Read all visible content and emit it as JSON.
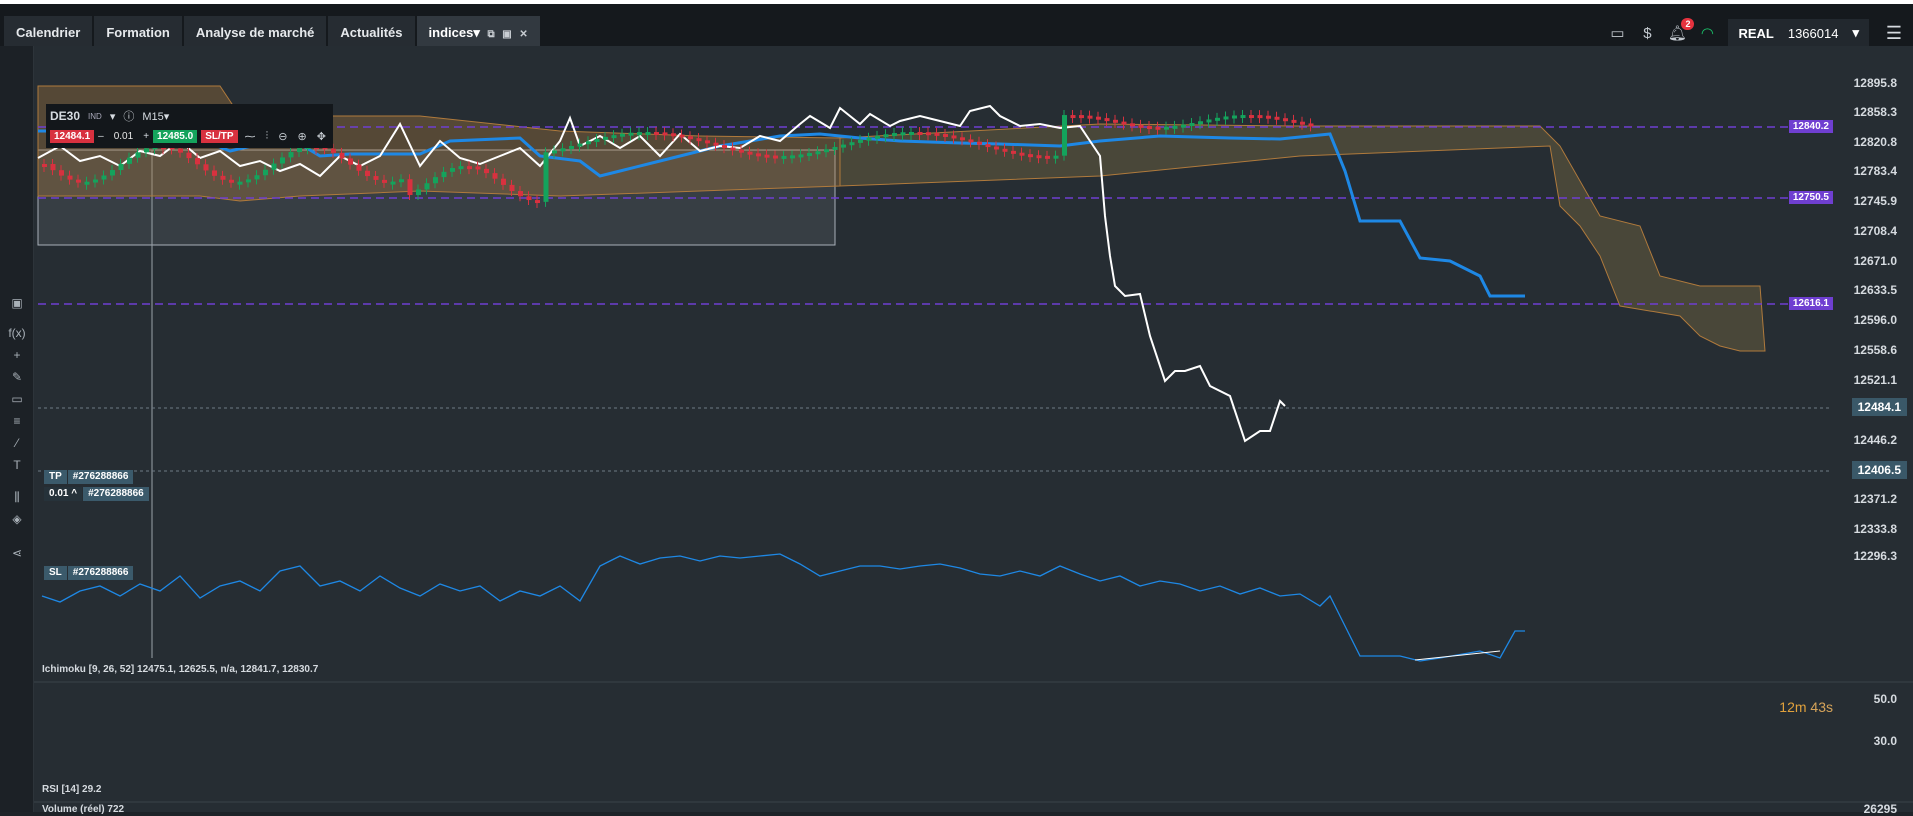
{
  "tabs": [
    {
      "label": "Calendrier"
    },
    {
      "label": "Formation"
    },
    {
      "label": "Analyse de marché"
    },
    {
      "label": "Actualités"
    },
    {
      "label": "indices▾"
    }
  ],
  "topbar_right": {
    "notifications_count": "2",
    "account_type": "REAL",
    "account_number": "1366014"
  },
  "instrument": {
    "symbol": "DE30",
    "tag": "IND",
    "timeframe": "M15▾",
    "sell_price": "12484.1",
    "qty": "0.01",
    "buy_price": "12485.0",
    "sltp_label": "SL/TP",
    "minus": "–",
    "plus": "+"
  },
  "price_axis": [
    "12895.8",
    "12858.3",
    "12820.8",
    "12783.4",
    "12745.9",
    "12708.4",
    "12671.0",
    "12633.5",
    "12596.0",
    "12558.6",
    "12521.1",
    "12446.2",
    "12371.2",
    "12333.8",
    "12296.3"
  ],
  "levels": {
    "hline1": "12840.2",
    "hline2": "12750.5",
    "hline3": "12616.1",
    "current": "12484.1",
    "sl": "12406.5"
  },
  "positions": {
    "tp_label": "TP",
    "tp_id": "#276288866",
    "qty_label": "0.01 ^",
    "pos_id": "#276288866",
    "sl_label": "SL",
    "sl_id": "#276288866"
  },
  "timer": {
    "minutes": "12m",
    "seconds": "43s"
  },
  "indicators": {
    "ichimoku": "Ichimoku [9, 26, 52] 12475.1, 12625.5, n/a, 12841.7, 12830.7",
    "rsi": "RSI [14] 29.2",
    "rsi_axis": [
      "50.0",
      "30.0"
    ],
    "volume": "Volume (réel) 722",
    "volume_axis": "26295"
  },
  "colors": {
    "accent": "#6f3fd1",
    "up": "#14a35c",
    "down": "#d8313f",
    "kijun": "#1e88e5",
    "cloud": "#b07a3c"
  }
}
